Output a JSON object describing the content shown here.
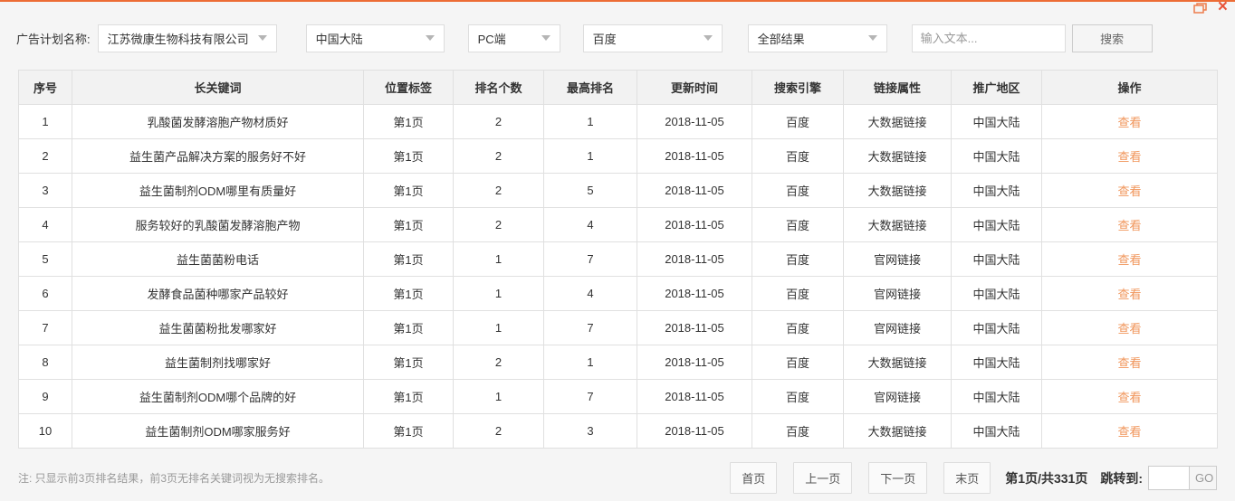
{
  "colors": {
    "accent": "#ed6c35",
    "link": "#f0955a"
  },
  "window": {
    "close_glyph": "×"
  },
  "filters": {
    "label": "广告计划名称:",
    "plan_selected": "江苏微康生物科技有限公司",
    "region_selected": "中国大陆",
    "device_selected": "PC端",
    "engine_selected": "百度",
    "result_selected": "全部结果",
    "search_placeholder": "输入文本...",
    "search_button": "搜索"
  },
  "table": {
    "headers": [
      "序号",
      "长关键词",
      "位置标签",
      "排名个数",
      "最高排名",
      "更新时间",
      "搜索引擎",
      "链接属性",
      "推广地区",
      "操作"
    ],
    "action_label": "查看",
    "rows": [
      [
        "1",
        "乳酸菌发酵溶胞产物材质好",
        "第1页",
        "2",
        "1",
        "2018-11-05",
        "百度",
        "大数据链接",
        "中国大陆"
      ],
      [
        "2",
        "益生菌产品解决方案的服务好不好",
        "第1页",
        "2",
        "1",
        "2018-11-05",
        "百度",
        "大数据链接",
        "中国大陆"
      ],
      [
        "3",
        "益生菌制剂ODM哪里有质量好",
        "第1页",
        "2",
        "5",
        "2018-11-05",
        "百度",
        "大数据链接",
        "中国大陆"
      ],
      [
        "4",
        "服务较好的乳酸菌发酵溶胞产物",
        "第1页",
        "2",
        "4",
        "2018-11-05",
        "百度",
        "大数据链接",
        "中国大陆"
      ],
      [
        "5",
        "益生菌菌粉电话",
        "第1页",
        "1",
        "7",
        "2018-11-05",
        "百度",
        "官网链接",
        "中国大陆"
      ],
      [
        "6",
        "发酵食品菌种哪家产品较好",
        "第1页",
        "1",
        "4",
        "2018-11-05",
        "百度",
        "官网链接",
        "中国大陆"
      ],
      [
        "7",
        "益生菌菌粉批发哪家好",
        "第1页",
        "1",
        "7",
        "2018-11-05",
        "百度",
        "官网链接",
        "中国大陆"
      ],
      [
        "8",
        "益生菌制剂找哪家好",
        "第1页",
        "2",
        "1",
        "2018-11-05",
        "百度",
        "大数据链接",
        "中国大陆"
      ],
      [
        "9",
        "益生菌制剂ODM哪个品牌的好",
        "第1页",
        "1",
        "7",
        "2018-11-05",
        "百度",
        "官网链接",
        "中国大陆"
      ],
      [
        "10",
        "益生菌制剂ODM哪家服务好",
        "第1页",
        "2",
        "3",
        "2018-11-05",
        "百度",
        "大数据链接",
        "中国大陆"
      ]
    ]
  },
  "footer": {
    "note": "注: 只显示前3页排名结果，前3页无排名关键词视为无搜索排名。",
    "pagination": {
      "first": "首页",
      "prev": "上一页",
      "next": "下一页",
      "last": "末页",
      "page_info": "第1页/共331页",
      "jump_label": "跳转到:",
      "go": "GO"
    }
  }
}
